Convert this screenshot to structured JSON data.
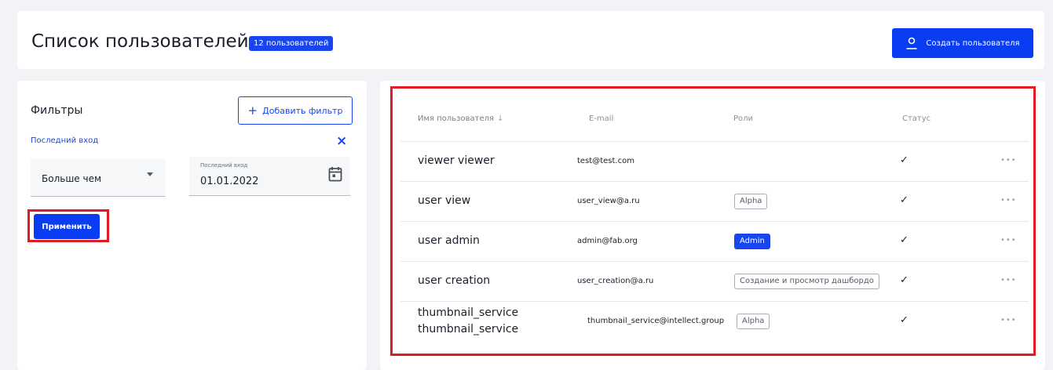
{
  "header": {
    "title": "Список пользователей",
    "count_badge": "12 пользователей",
    "create_button": "Создать пользователя"
  },
  "filters": {
    "title": "Фильтры",
    "add_filter_button": "Добавить фильтр",
    "active_filter_label": "Последний вход",
    "operator_select": "Больше чем",
    "date_field_label": "Последний вход",
    "date_field_value": "01.01.2022",
    "apply_button": "Применить"
  },
  "table": {
    "columns": {
      "name": "Имя пользователя",
      "email": "E-mail",
      "roles": "Роли",
      "status": "Статус"
    },
    "sort_indicator": "↓",
    "rows": [
      {
        "name": "viewer viewer",
        "email": "test@test.com",
        "role": "",
        "role_style": "",
        "status": "✓",
        "more": "•••"
      },
      {
        "name": "user view",
        "email": "user_view@a.ru",
        "role": "Alpha",
        "role_style": "outline",
        "status": "✓",
        "more": "•••"
      },
      {
        "name": "user admin",
        "email": "admin@fab.org",
        "role": "Admin",
        "role_style": "filled",
        "status": "✓",
        "more": "•••"
      },
      {
        "name": "user creation",
        "email": "user_creation@a.ru",
        "role": "Создание и просмотр дашбордо",
        "role_style": "outline",
        "status": "✓",
        "more": "•••"
      },
      {
        "name_line1": "thumbnail_service",
        "name_line2": "thumbnail_service",
        "email": "thumbnail_service@intellect.group",
        "role": "Alpha",
        "role_style": "outline",
        "status": "✓",
        "more": "•••"
      }
    ]
  },
  "colors": {
    "accent": "#0a3cf2",
    "highlight": "#e01b22"
  }
}
